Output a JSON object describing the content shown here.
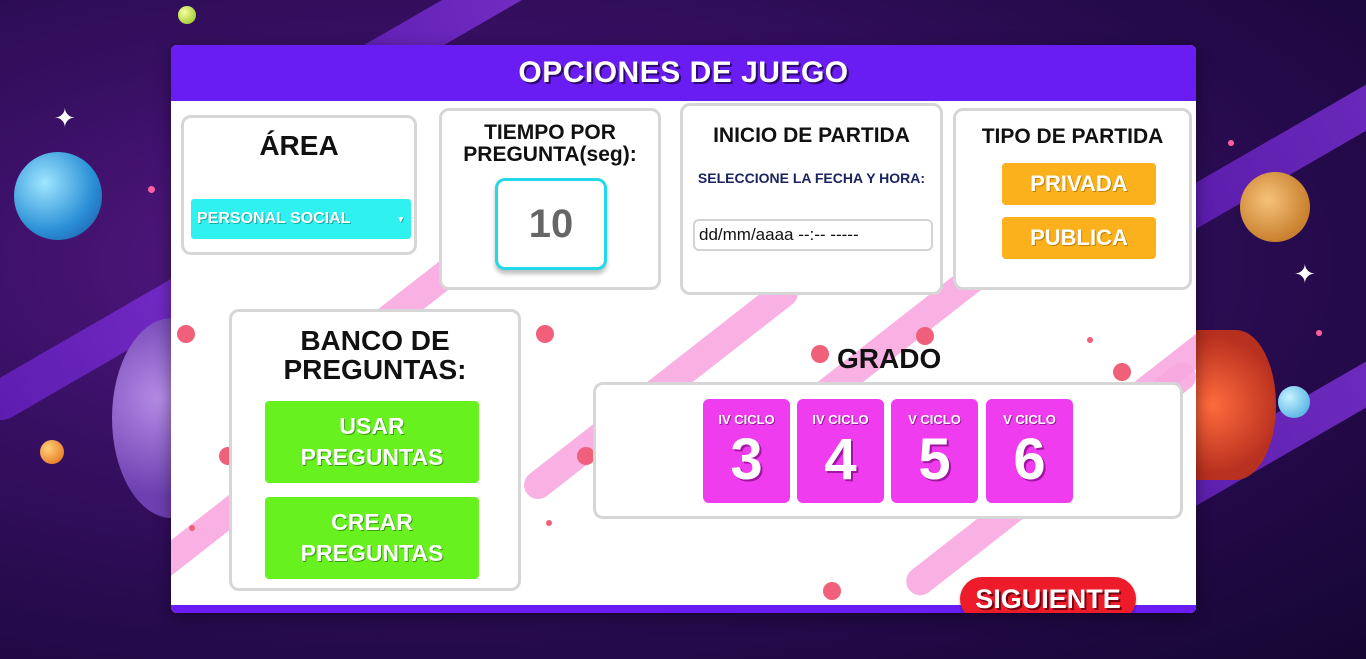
{
  "header": {
    "title": "OPCIONES DE JUEGO"
  },
  "area": {
    "title": "ÁREA",
    "selected": "PERSONAL SOCIAL"
  },
  "tiempo": {
    "title": "TIEMPO POR PREGUNTA(seg):",
    "value": "10"
  },
  "inicio": {
    "title": "INICIO DE PARTIDA",
    "subtitle": "SELECCIONE LA FECHA Y HORA:",
    "placeholder": "dd/mm/aaaa --:-- -----"
  },
  "tipo": {
    "title": "TIPO DE PARTIDA",
    "options": [
      {
        "label": "PRIVADA"
      },
      {
        "label": "PUBLICA"
      }
    ]
  },
  "banco": {
    "title": "BANCO DE PREGUNTAS:",
    "buttons": [
      {
        "label": "USAR PREGUNTAS"
      },
      {
        "label": "CREAR PREGUNTAS"
      }
    ]
  },
  "grado": {
    "title": "GRADO",
    "options": [
      {
        "ciclo": "IV CICLO",
        "number": "3"
      },
      {
        "ciclo": "IV CICLO",
        "number": "4"
      },
      {
        "ciclo": "V CICLO",
        "number": "5"
      },
      {
        "ciclo": "V CICLO",
        "number": "6"
      }
    ]
  },
  "footer": {
    "next_label": "SIGUIENTE"
  },
  "colors": {
    "header": "#6a1df2",
    "area_select": "#2ff2f0",
    "time_border": "#23d8e8",
    "tipo_buttons": "#fbb11b",
    "banco_buttons": "#67f21f",
    "grado_cards": "#ef3cef",
    "next_button": "#ee1c2a"
  }
}
